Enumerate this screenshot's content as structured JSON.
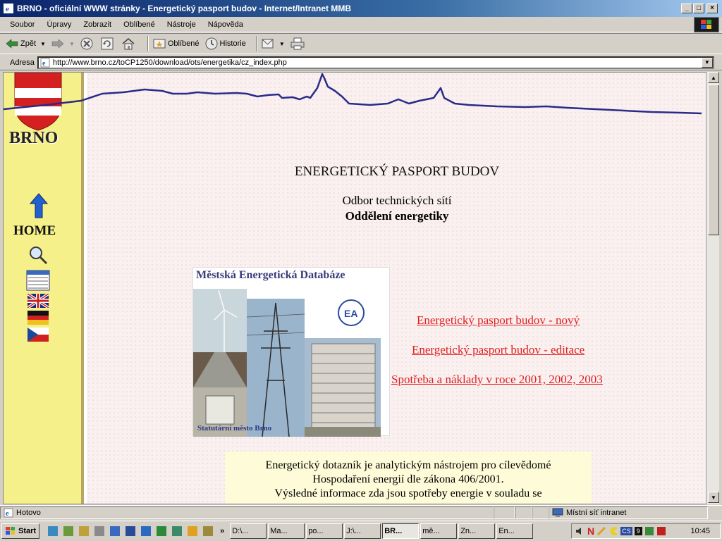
{
  "window": {
    "title": "BRNO - oficiální WWW stránky - Energetický pasport budov - Internet/Intranet MMB"
  },
  "menu": {
    "items": [
      "Soubor",
      "Úpravy",
      "Zobrazit",
      "Oblíbené",
      "Nástroje",
      "Nápověda"
    ]
  },
  "toolbar": {
    "back": "Zpět",
    "favorites": "Oblíbené",
    "history": "Historie"
  },
  "address": {
    "label": "Adresa",
    "url": "http://www.brno.cz/toCP1250/download/ots/energetika/cz_index.php"
  },
  "sidebar": {
    "city": "BRNO",
    "home": "HOME"
  },
  "page": {
    "title": "ENERGETICKÝ PASPORT BUDOV",
    "dept1": "Odbor technických sítí",
    "dept2": "Oddělení energetiky",
    "db_title": "Městská Energetická Databáze",
    "db_caption": "Statutární město Brno",
    "links": [
      "Energetický pasport budov - nový",
      "Energetický pasport budov - editace",
      "Spotřeba a náklady v roce 2001, 2002, 2003"
    ],
    "info_lines": [
      "Energetický dotazník je analytickým nástrojem pro cílevědomé",
      "Hospodaření energií dle zákona 406/2001.",
      "Výsledné informace zda jsou spotřeby energie v souladu se"
    ]
  },
  "status": {
    "text": "Hotovo",
    "zone": "Místní síť intranet"
  },
  "taskbar": {
    "start": "Start",
    "tasks": [
      "D:\\...",
      "Ma...",
      "po...",
      "J:\\...",
      "BR...",
      "mě...",
      "Zn...",
      "En..."
    ],
    "time": "10:45"
  }
}
